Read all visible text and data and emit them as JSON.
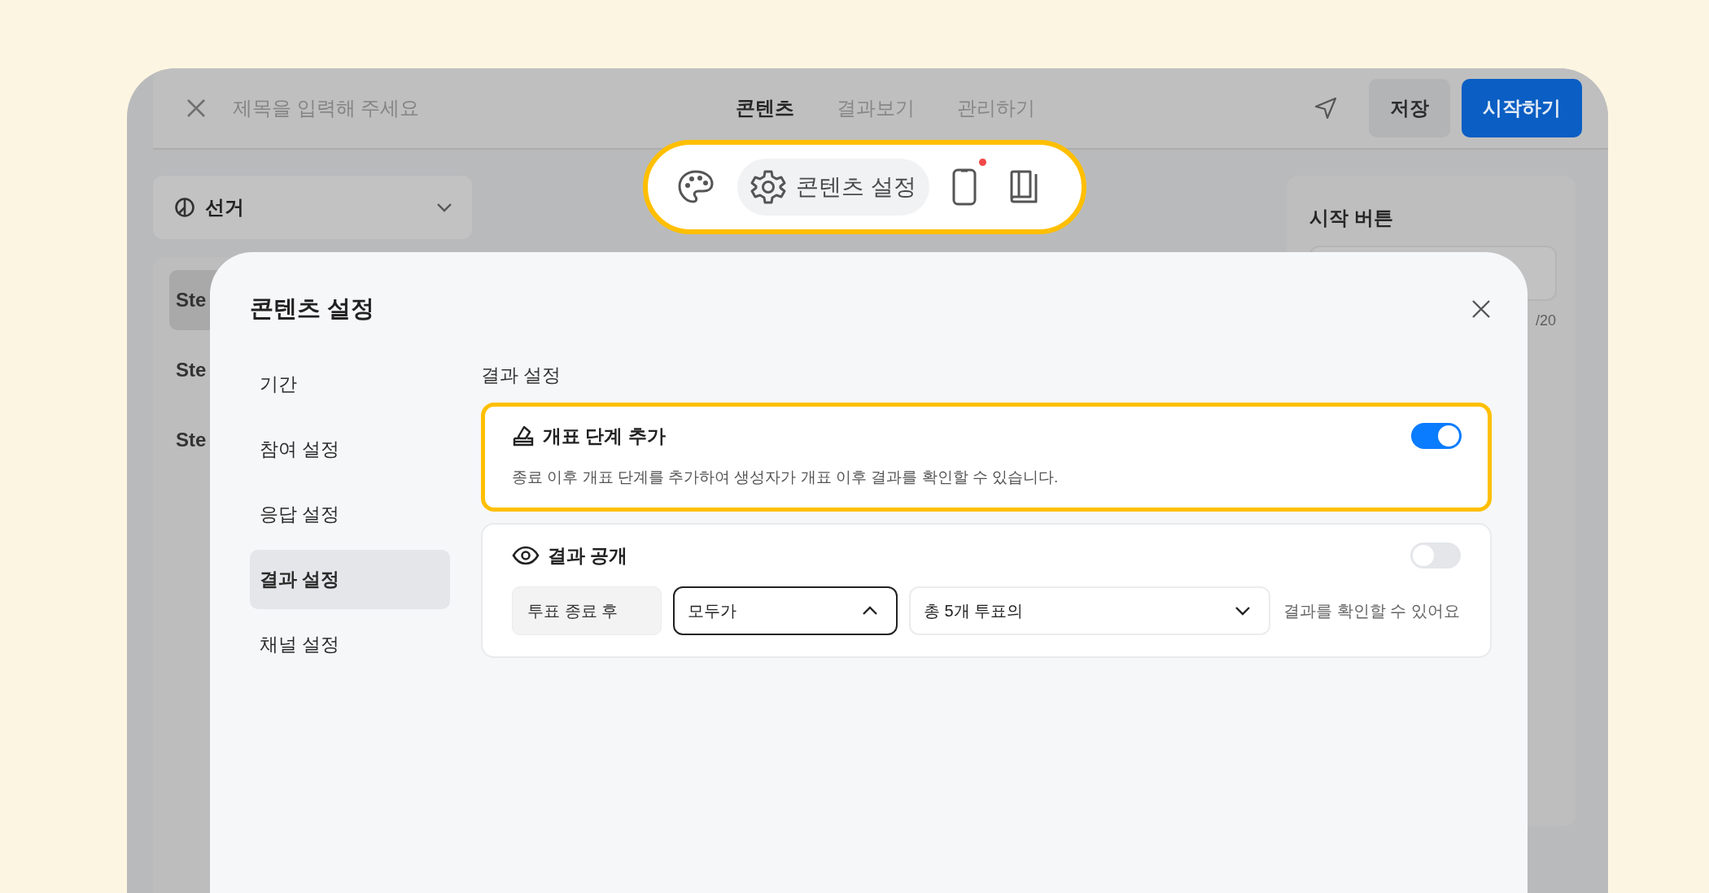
{
  "header": {
    "title_placeholder": "제목을 입력해 주세요",
    "tabs": [
      {
        "label": "콘텐츠",
        "selected": true
      },
      {
        "label": "결과보기",
        "selected": false
      },
      {
        "label": "관리하기",
        "selected": false
      }
    ],
    "buttons": [
      {
        "label": "저장",
        "kind": "secondary"
      },
      {
        "label": "시작하기",
        "kind": "primary"
      }
    ]
  },
  "left_panel": {
    "dropdown": {
      "value": "선거"
    },
    "items": [
      {
        "label": "Ste",
        "selected": true
      },
      {
        "label": "Ste",
        "selected": false
      },
      {
        "label": "Ste",
        "selected": false
      }
    ]
  },
  "right_panel": {
    "section_title": "시작 버튼",
    "counter": "/20"
  },
  "toolbar": {
    "items": [
      {
        "kind": "palette",
        "selected": false,
        "notification": false
      },
      {
        "kind": "settings",
        "label": "콘텐츠 설정",
        "selected": true,
        "notification": false
      },
      {
        "kind": "phone",
        "selected": false,
        "notification": true
      },
      {
        "kind": "book",
        "selected": false,
        "notification": false
      }
    ]
  },
  "modal": {
    "title": "콘텐츠 설정",
    "nav": [
      {
        "label": "기간",
        "selected": false
      },
      {
        "label": "참여 설정",
        "selected": false
      },
      {
        "label": "응답 설정",
        "selected": false
      },
      {
        "label": "결과 설정",
        "selected": true
      },
      {
        "label": "채널 설정",
        "selected": false
      }
    ],
    "section_title": "결과 설정",
    "settings": [
      {
        "kind": "ballot",
        "title": "개표 단계 추가",
        "description": "종료 이후 개표 단계를 추가하여 생성자가 개표 이후 결과를 확인할 수 있습니다.",
        "on": true,
        "highlighted": true
      },
      {
        "kind": "visibility",
        "title": "결과 공개",
        "on": false,
        "highlighted": false,
        "condition": {
          "label": "투표 종료 후",
          "audience": {
            "value": "모두가",
            "expanded": true
          },
          "scope": {
            "value": "총 5개 투표의",
            "expanded": false
          },
          "suffix": "결과를 확인할 수 있어요"
        }
      }
    ]
  }
}
